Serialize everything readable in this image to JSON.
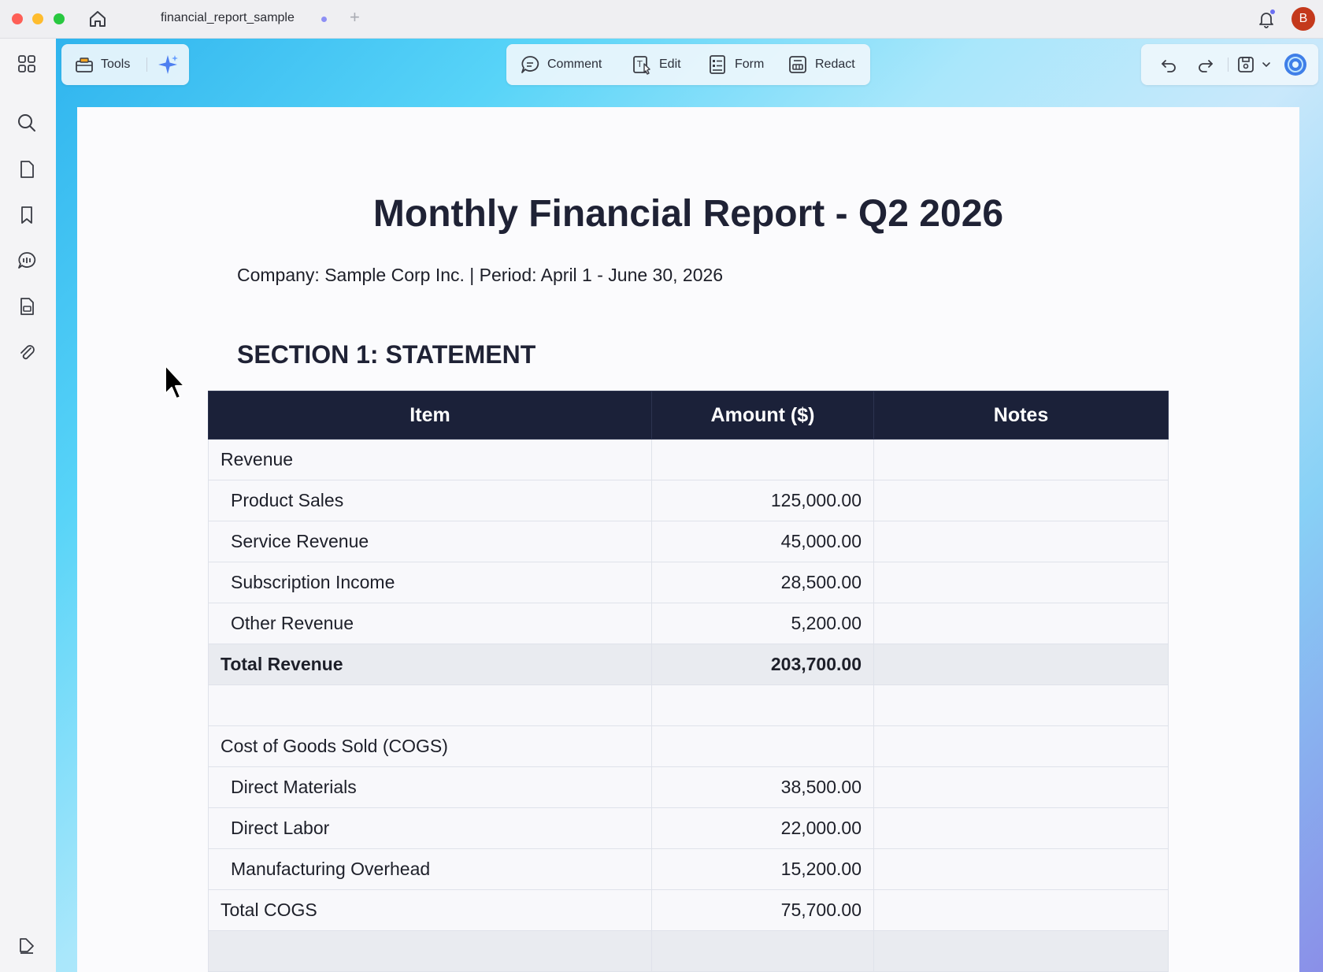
{
  "tab": {
    "title": "financial_report_sample"
  },
  "user": {
    "avatar_initial": "B"
  },
  "toolbar": {
    "tools_label": "Tools",
    "comment_label": "Comment",
    "edit_label": "Edit",
    "form_label": "Form",
    "redact_label": "Redact"
  },
  "icons": {
    "rail": [
      "apps-grid-icon",
      "search-icon",
      "page-icon",
      "bookmark-icon",
      "comments-icon",
      "stamp-icon",
      "attachment-icon"
    ],
    "rail_bottom": "sign-icon"
  },
  "document": {
    "title": "Monthly Financial Report - Q2 2026",
    "subtitle": "Company: Sample Corp Inc. | Period: April 1 - June 30, 2026",
    "section": "SECTION 1:  STATEMENT",
    "table": {
      "headers": [
        "Item",
        "Amount ($)",
        "Notes"
      ],
      "rows": [
        {
          "item": "Revenue",
          "amount": "",
          "notes": "",
          "kind": "group"
        },
        {
          "item": "Product Sales",
          "amount": "125,000.00",
          "notes": "",
          "kind": "sub"
        },
        {
          "item": "Service Revenue",
          "amount": "45,000.00",
          "notes": "",
          "kind": "sub"
        },
        {
          "item": "Subscription Income",
          "amount": "28,500.00",
          "notes": "",
          "kind": "sub"
        },
        {
          "item": "Other Revenue",
          "amount": "5,200.00",
          "notes": "",
          "kind": "sub"
        },
        {
          "item": "Total Revenue",
          "amount": "203,700.00",
          "notes": "",
          "kind": "total"
        },
        {
          "item": "",
          "amount": "",
          "notes": "",
          "kind": "blank"
        },
        {
          "item": "Cost of Goods Sold (COGS)",
          "amount": "",
          "notes": "",
          "kind": "group"
        },
        {
          "item": "Direct Materials",
          "amount": "38,500.00",
          "notes": "",
          "kind": "sub"
        },
        {
          "item": "Direct Labor",
          "amount": "22,000.00",
          "notes": "",
          "kind": "sub"
        },
        {
          "item": "Manufacturing Overhead",
          "amount": "15,200.00",
          "notes": "",
          "kind": "sub"
        },
        {
          "item": "Total COGS",
          "amount": "75,700.00",
          "notes": "",
          "kind": "group"
        },
        {
          "item": "",
          "amount": "",
          "notes": "",
          "kind": "shaded"
        }
      ]
    }
  },
  "colors": {
    "table_header_bg": "#1b2139",
    "accent": "#6b6ff2",
    "avatar_bg": "#c4391c"
  }
}
